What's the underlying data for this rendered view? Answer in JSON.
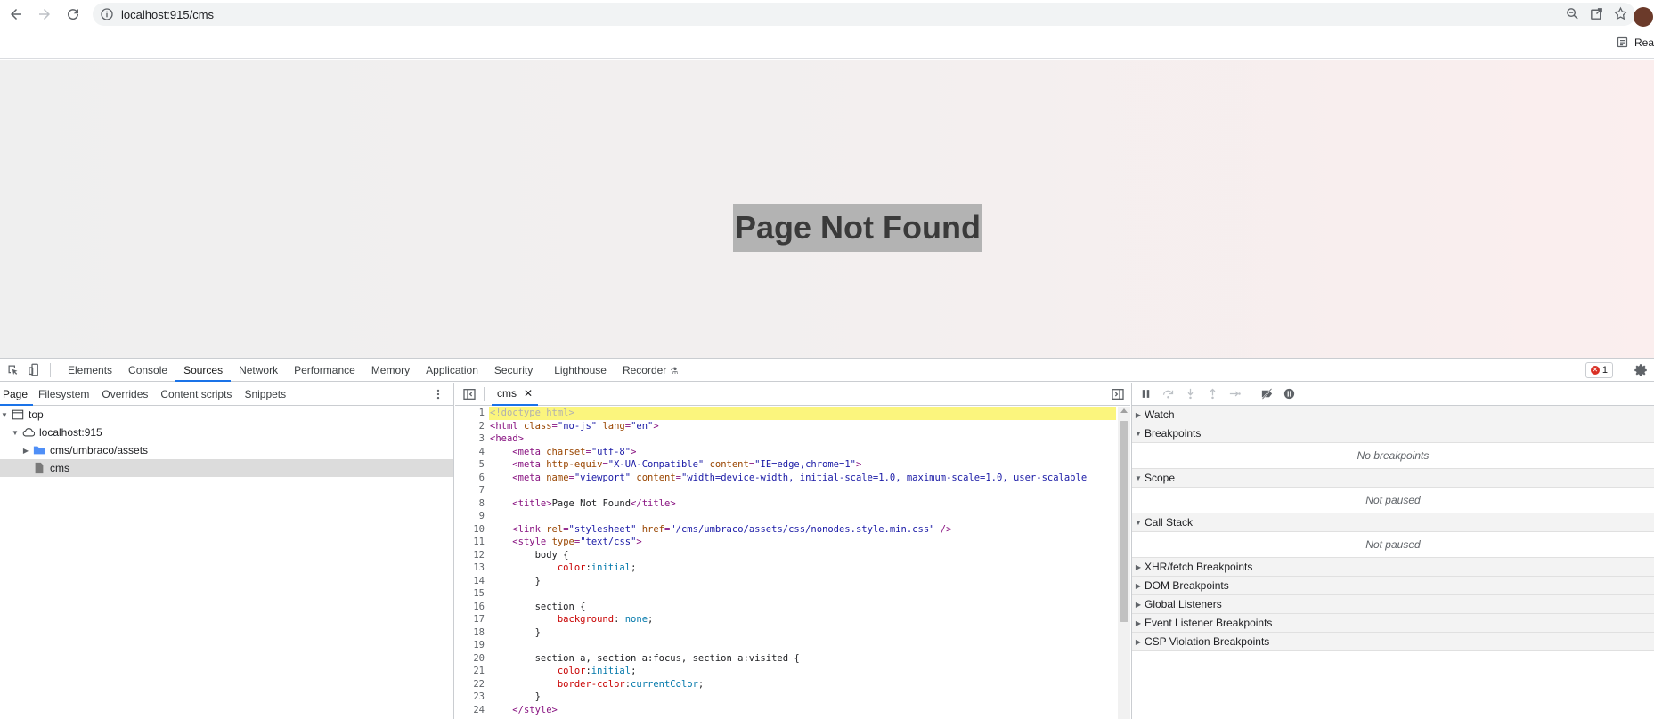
{
  "browser": {
    "url": "localhost:915/cms",
    "reading_list_label": "Rea"
  },
  "page": {
    "heading": "Page Not Found"
  },
  "devtools": {
    "tabs": [
      "Elements",
      "Console",
      "Sources",
      "Network",
      "Performance",
      "Memory",
      "Application",
      "Security",
      "Lighthouse",
      "Recorder"
    ],
    "active_tab": "Sources",
    "error_count": "1",
    "navigator": {
      "tabs": [
        "Page",
        "Filesystem",
        "Overrides",
        "Content scripts",
        "Snippets"
      ],
      "active_tab": "Page",
      "tree": [
        {
          "label": "top",
          "depth": 0,
          "icon": "frame-icon",
          "expanded": true
        },
        {
          "label": "localhost:915",
          "depth": 1,
          "icon": "cloud-icon",
          "expanded": true
        },
        {
          "label": "cms/umbraco/assets",
          "depth": 2,
          "icon": "folder-icon",
          "expanded": false
        },
        {
          "label": "cms",
          "depth": 2,
          "icon": "file-icon",
          "selected": true
        }
      ]
    },
    "editor": {
      "file_tab": "cms",
      "highlighted_line": 1,
      "lines": [
        {
          "n": "1",
          "tokens": [
            [
              "dt",
              "<!doctype html>"
            ]
          ]
        },
        {
          "n": "2",
          "tokens": [
            [
              "tag",
              "<html "
            ],
            [
              "attr",
              "class"
            ],
            [
              "tag",
              "="
            ],
            [
              "val",
              "\"no-js\""
            ],
            [
              "tag",
              " "
            ],
            [
              "attr",
              "lang"
            ],
            [
              "tag",
              "="
            ],
            [
              "val",
              "\"en\""
            ],
            [
              "tag",
              ">"
            ]
          ]
        },
        {
          "n": "3",
          "tokens": [
            [
              "tag",
              "<head>"
            ]
          ]
        },
        {
          "n": "4",
          "tokens": [
            [
              "text",
              "    "
            ],
            [
              "tag",
              "<meta "
            ],
            [
              "attr",
              "charset"
            ],
            [
              "tag",
              "="
            ],
            [
              "val",
              "\"utf-8\""
            ],
            [
              "tag",
              ">"
            ]
          ]
        },
        {
          "n": "5",
          "tokens": [
            [
              "text",
              "    "
            ],
            [
              "tag",
              "<meta "
            ],
            [
              "attr",
              "http-equiv"
            ],
            [
              "tag",
              "="
            ],
            [
              "val",
              "\"X-UA-Compatible\""
            ],
            [
              "tag",
              " "
            ],
            [
              "attr",
              "content"
            ],
            [
              "tag",
              "="
            ],
            [
              "val",
              "\"IE=edge,chrome=1\""
            ],
            [
              "tag",
              ">"
            ]
          ]
        },
        {
          "n": "6",
          "tokens": [
            [
              "text",
              "    "
            ],
            [
              "tag",
              "<meta "
            ],
            [
              "attr",
              "name"
            ],
            [
              "tag",
              "="
            ],
            [
              "val",
              "\"viewport\""
            ],
            [
              "tag",
              " "
            ],
            [
              "attr",
              "content"
            ],
            [
              "tag",
              "="
            ],
            [
              "val",
              "\"width=device-width, initial-scale=1.0, maximum-scale=1.0, user-scalable"
            ]
          ]
        },
        {
          "n": "7",
          "tokens": []
        },
        {
          "n": "8",
          "tokens": [
            [
              "text",
              "    "
            ],
            [
              "tag",
              "<title>"
            ],
            [
              "text",
              "Page Not Found"
            ],
            [
              "tag",
              "</title>"
            ]
          ]
        },
        {
          "n": "9",
          "tokens": []
        },
        {
          "n": "10",
          "tokens": [
            [
              "text",
              "    "
            ],
            [
              "tag",
              "<link "
            ],
            [
              "attr",
              "rel"
            ],
            [
              "tag",
              "="
            ],
            [
              "val",
              "\"stylesheet\""
            ],
            [
              "tag",
              " "
            ],
            [
              "attr",
              "href"
            ],
            [
              "tag",
              "="
            ],
            [
              "val",
              "\"/cms/umbraco/assets/css/nonodes.style.min.css\""
            ],
            [
              "tag",
              " />"
            ]
          ]
        },
        {
          "n": "11",
          "tokens": [
            [
              "text",
              "    "
            ],
            [
              "tag",
              "<style "
            ],
            [
              "attr",
              "type"
            ],
            [
              "tag",
              "="
            ],
            [
              "val",
              "\"text/css\""
            ],
            [
              "tag",
              ">"
            ]
          ]
        },
        {
          "n": "12",
          "tokens": [
            [
              "text",
              "        body {"
            ]
          ]
        },
        {
          "n": "13",
          "tokens": [
            [
              "text",
              "            "
            ],
            [
              "prop",
              "color"
            ],
            [
              "text",
              ":"
            ],
            [
              "kw",
              "initial"
            ],
            [
              "text",
              ";"
            ]
          ]
        },
        {
          "n": "14",
          "tokens": [
            [
              "text",
              "        }"
            ]
          ]
        },
        {
          "n": "15",
          "tokens": []
        },
        {
          "n": "16",
          "tokens": [
            [
              "text",
              "        section {"
            ]
          ]
        },
        {
          "n": "17",
          "tokens": [
            [
              "text",
              "            "
            ],
            [
              "prop",
              "background"
            ],
            [
              "text",
              ": "
            ],
            [
              "kw",
              "none"
            ],
            [
              "text",
              ";"
            ]
          ]
        },
        {
          "n": "18",
          "tokens": [
            [
              "text",
              "        }"
            ]
          ]
        },
        {
          "n": "19",
          "tokens": []
        },
        {
          "n": "20",
          "tokens": [
            [
              "text",
              "        section a, section a:focus, section a:visited {"
            ]
          ]
        },
        {
          "n": "21",
          "tokens": [
            [
              "text",
              "            "
            ],
            [
              "prop",
              "color"
            ],
            [
              "text",
              ":"
            ],
            [
              "kw",
              "initial"
            ],
            [
              "text",
              ";"
            ]
          ]
        },
        {
          "n": "22",
          "tokens": [
            [
              "text",
              "            "
            ],
            [
              "prop",
              "border-color"
            ],
            [
              "text",
              ":"
            ],
            [
              "kw",
              "currentColor"
            ],
            [
              "text",
              ";"
            ]
          ]
        },
        {
          "n": "23",
          "tokens": [
            [
              "text",
              "        }"
            ]
          ]
        },
        {
          "n": "24",
          "tokens": [
            [
              "text",
              "    "
            ],
            [
              "tag",
              "</style>"
            ]
          ]
        }
      ]
    },
    "debugger": {
      "panes": [
        {
          "title": "Watch",
          "expanded": false
        },
        {
          "title": "Breakpoints",
          "expanded": true,
          "body": "No breakpoints"
        },
        {
          "title": "Scope",
          "expanded": true,
          "body": "Not paused"
        },
        {
          "title": "Call Stack",
          "expanded": true,
          "body": "Not paused"
        },
        {
          "title": "XHR/fetch Breakpoints",
          "expanded": false
        },
        {
          "title": "DOM Breakpoints",
          "expanded": false
        },
        {
          "title": "Global Listeners",
          "expanded": false
        },
        {
          "title": "Event Listener Breakpoints",
          "expanded": false
        },
        {
          "title": "CSP Violation Breakpoints",
          "expanded": false
        }
      ]
    }
  }
}
